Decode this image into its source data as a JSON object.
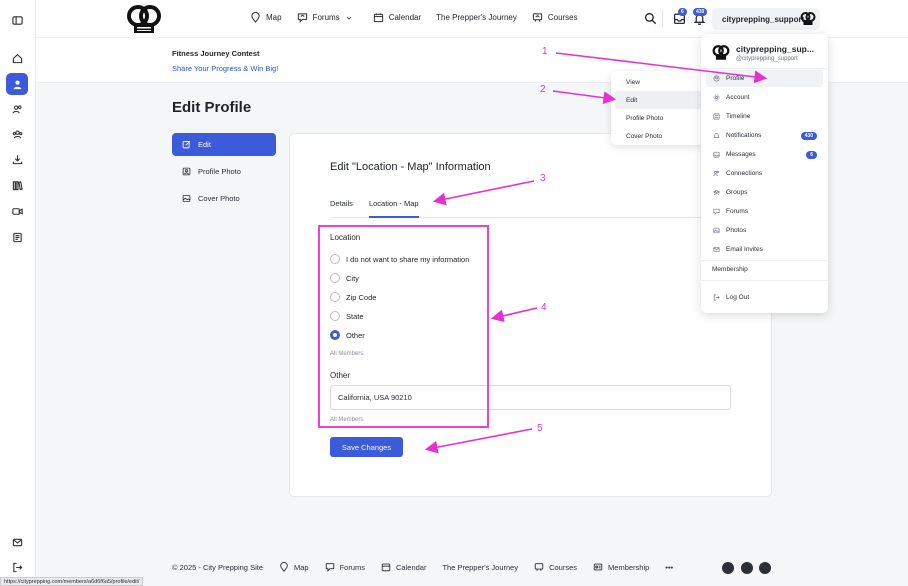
{
  "header": {
    "nav": [
      {
        "icon": "map-pin-icon",
        "label": "Map"
      },
      {
        "icon": "forums-icon",
        "label": "Forums"
      },
      {
        "icon": "calendar-icon",
        "label": "Calendar"
      },
      {
        "icon": "",
        "label": "The Prepper's Journey"
      },
      {
        "icon": "courses-icon",
        "label": "Courses"
      }
    ],
    "inbox_count": "6",
    "notif_count": "430",
    "username": "cityprepping_support"
  },
  "banner": {
    "title": "Fitness Journey Contest",
    "link": "Share Your Progress & Win Big!"
  },
  "page_title": "Edit Profile",
  "profile_menu": [
    {
      "label": "Edit"
    },
    {
      "label": "Profile Photo"
    },
    {
      "label": "Cover Photo"
    }
  ],
  "form": {
    "heading": "Edit \"Location - Map\" Information",
    "tabs": [
      "Details",
      "Location - Map"
    ],
    "location_label": "Location",
    "options": [
      "I do not want to share my information",
      "City",
      "Zip Code",
      "State",
      "Other"
    ],
    "selected_option": "Other",
    "visibility_1": "All Members",
    "other_label": "Other",
    "other_value": "California, USA 90210",
    "visibility_2": "All Members",
    "save_label": "Save Changes"
  },
  "profile_dropdown": {
    "items": [
      "View",
      "Edit",
      "Profile Photo",
      "Cover Photo"
    ]
  },
  "user_dropdown": {
    "name": "cityprepping_sup...",
    "handle": "@cityprepping_support",
    "items": [
      {
        "label": "Profile",
        "icon": "user-icon"
      },
      {
        "label": "Account",
        "icon": "gear-icon"
      },
      {
        "label": "Timeline",
        "icon": "timeline-icon"
      },
      {
        "label": "Notifications",
        "icon": "bell-icon",
        "count": "430"
      },
      {
        "label": "Messages",
        "icon": "inbox-icon",
        "count": "6"
      },
      {
        "label": "Connections",
        "icon": "connections-icon"
      },
      {
        "label": "Groups",
        "icon": "groups-icon"
      },
      {
        "label": "Forums",
        "icon": "forums-icon"
      },
      {
        "label": "Photos",
        "icon": "photos-icon"
      },
      {
        "label": "Email Invites",
        "icon": "email-icon"
      }
    ],
    "membership": "Membership",
    "logout": "Log Out"
  },
  "footer": {
    "copyright": "© 2025 - City Prepping Site",
    "links": [
      "Map",
      "Forums",
      "Calendar",
      "The Prepper's Journey",
      "Courses",
      "Membership"
    ],
    "more": "•••"
  },
  "status_url": "https://cityprepping.com/members/a6d6f6a5/profile/edit/",
  "annotations": [
    "1",
    "2",
    "3",
    "4",
    "5"
  ],
  "colors": {
    "accent": "#3b5bdb",
    "annotation": "#ee3fd9"
  }
}
